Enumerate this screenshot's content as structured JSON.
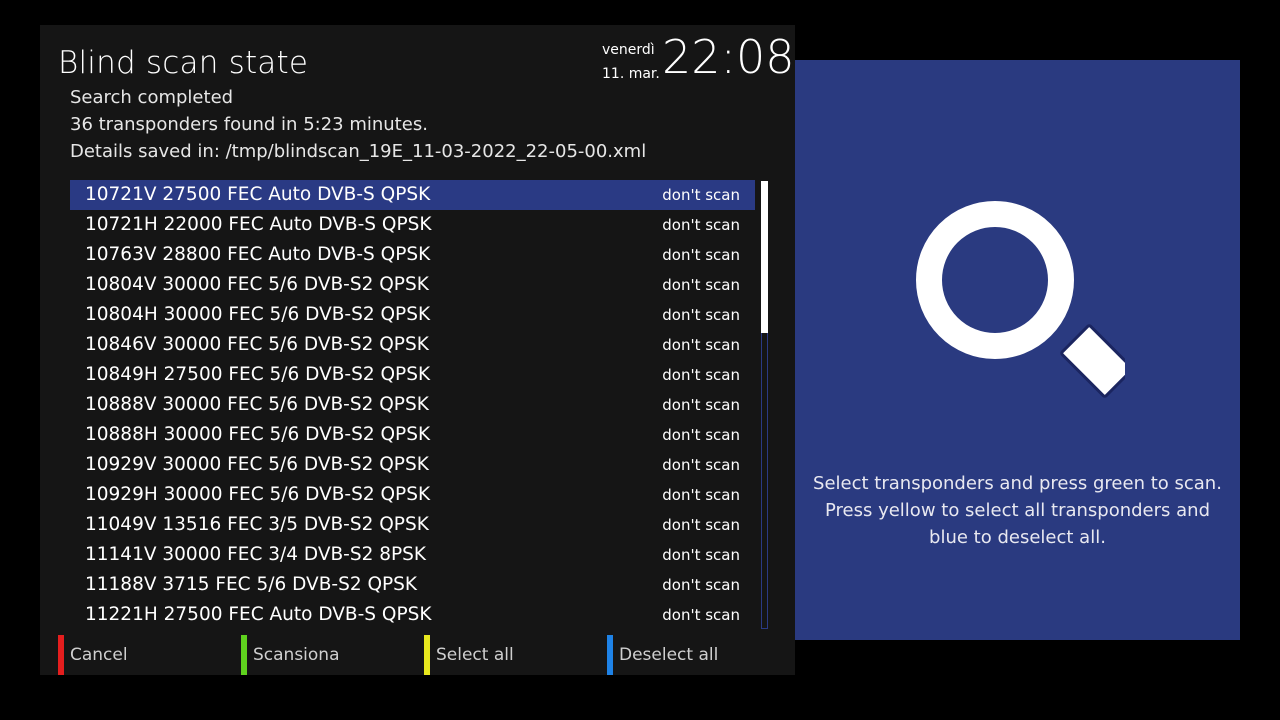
{
  "header": {
    "title": "Blind scan state",
    "day": "venerdì",
    "date": "11. mar.",
    "time": "22:08"
  },
  "status": {
    "line1": "Search completed",
    "line2": "36 transponders found in 5:23 minutes.",
    "line3": "Details saved in: /tmp/blindscan_19E_11-03-2022_22-05-00.xml"
  },
  "list": {
    "selected_index": 0,
    "scroll_position_fraction": 0.0,
    "scroll_visible_fraction": 0.34,
    "items": [
      {
        "label": "10721V 27500 FEC Auto DVB-S QPSK",
        "state": "don't scan"
      },
      {
        "label": "10721H 22000 FEC Auto DVB-S QPSK",
        "state": "don't scan"
      },
      {
        "label": "10763V 28800 FEC Auto DVB-S QPSK",
        "state": "don't scan"
      },
      {
        "label": "10804V 30000 FEC 5/6 DVB-S2 QPSK",
        "state": "don't scan"
      },
      {
        "label": "10804H 30000 FEC 5/6 DVB-S2 QPSK",
        "state": "don't scan"
      },
      {
        "label": "10846V 30000 FEC 5/6 DVB-S2 QPSK",
        "state": "don't scan"
      },
      {
        "label": "10849H 27500 FEC 5/6 DVB-S2 QPSK",
        "state": "don't scan"
      },
      {
        "label": "10888V 30000 FEC 5/6 DVB-S2 QPSK",
        "state": "don't scan"
      },
      {
        "label": "10888H 30000 FEC 5/6 DVB-S2 QPSK",
        "state": "don't scan"
      },
      {
        "label": "10929V 30000 FEC 5/6 DVB-S2 QPSK",
        "state": "don't scan"
      },
      {
        "label": "10929H 30000 FEC 5/6 DVB-S2 QPSK",
        "state": "don't scan"
      },
      {
        "label": "11049V 13516 FEC 3/5 DVB-S2 QPSK",
        "state": "don't scan"
      },
      {
        "label": "11141V 30000 FEC 3/4 DVB-S2 8PSK",
        "state": "don't scan"
      },
      {
        "label": "11188V 3715 FEC 5/6 DVB-S2 QPSK",
        "state": "don't scan"
      },
      {
        "label": "11221H 27500 FEC Auto DVB-S QPSK",
        "state": "don't scan"
      }
    ]
  },
  "footer": {
    "red_label": "Cancel",
    "green_label": "Scansiona",
    "yellow_label": "Select all",
    "blue_label": "Deselect all",
    "colors": {
      "red": "#e41e1e",
      "green": "#5fd21e",
      "yellow": "#e8e81e",
      "blue": "#1e82e6"
    }
  },
  "info": {
    "icon": "magnifier-icon",
    "help_text": "Select transponders and press green to scan. Press yellow to select all transponders and blue to deselect all."
  },
  "colors": {
    "panel_background": "#151515",
    "selection": "#2a3a84",
    "info_background": "#2a3a80"
  }
}
